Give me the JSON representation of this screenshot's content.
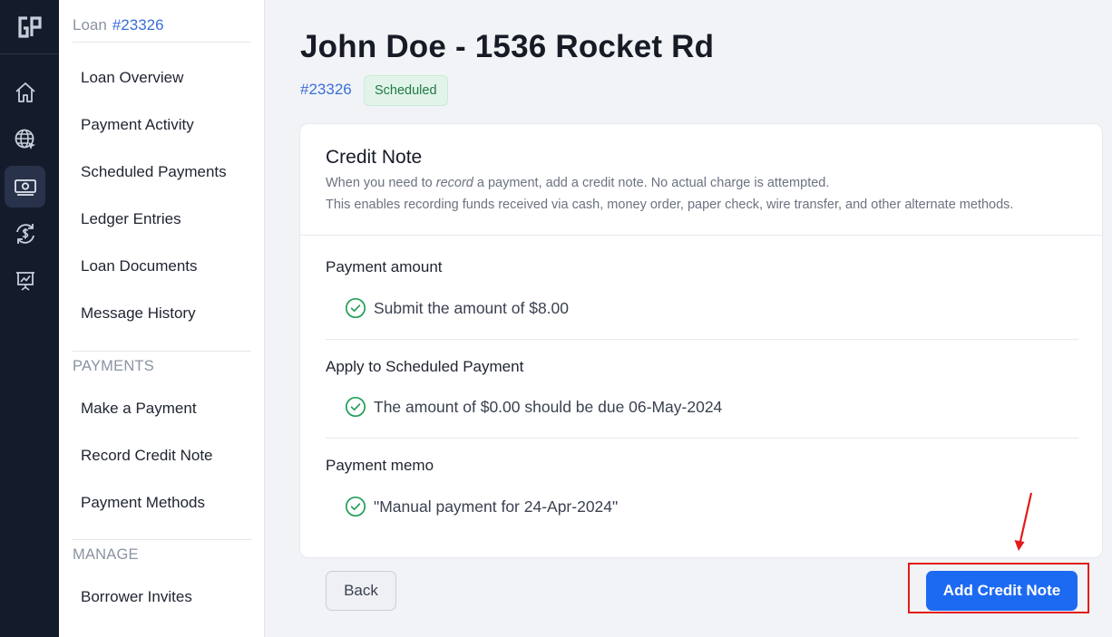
{
  "rail": {
    "logo": "GP",
    "icons": [
      "home-icon",
      "globe-cursor-icon",
      "banknote-icon",
      "dollar-exchange-icon",
      "presentation-chart-icon"
    ],
    "active_index": 2
  },
  "subnav": {
    "loan_label": "Loan",
    "loan_number": "#23326",
    "items": [
      {
        "label": "Loan Overview"
      },
      {
        "label": "Payment Activity"
      },
      {
        "label": "Scheduled Payments"
      },
      {
        "label": "Ledger Entries"
      },
      {
        "label": "Loan Documents"
      },
      {
        "label": "Message History"
      }
    ],
    "payments_section": "PAYMENTS",
    "payments_items": [
      {
        "label": "Make a Payment"
      },
      {
        "label": "Record Credit Note"
      },
      {
        "label": "Payment Methods"
      }
    ],
    "manage_section": "MANAGE",
    "manage_items": [
      {
        "label": "Borrower Invites"
      }
    ]
  },
  "header": {
    "title": "John Doe - 1536 Rocket Rd",
    "loan_number": "#23326",
    "status": "Scheduled"
  },
  "card": {
    "title": "Credit Note",
    "desc_line1_pre": "When you need to ",
    "desc_line1_em": "record",
    "desc_line1_post": " a payment, add a credit note. No actual charge is attempted.",
    "desc_line2": "This enables recording funds received via cash, money order, paper check, wire transfer, and other alternate methods.",
    "sections": [
      {
        "label": "Payment amount",
        "value": "Submit the amount of $8.00"
      },
      {
        "label": "Apply to Scheduled Payment",
        "value": "The amount of $0.00 should be due 06-May-2024"
      },
      {
        "label": "Payment memo",
        "value": "\"Manual payment for 24-Apr-2024\""
      }
    ]
  },
  "actions": {
    "back_label": "Back",
    "submit_label": "Add Credit Note"
  },
  "colors": {
    "rail_bg": "#141c2c",
    "accent": "#1d6af2",
    "success": "#1f9d55",
    "annotation": "#e21b1b"
  }
}
